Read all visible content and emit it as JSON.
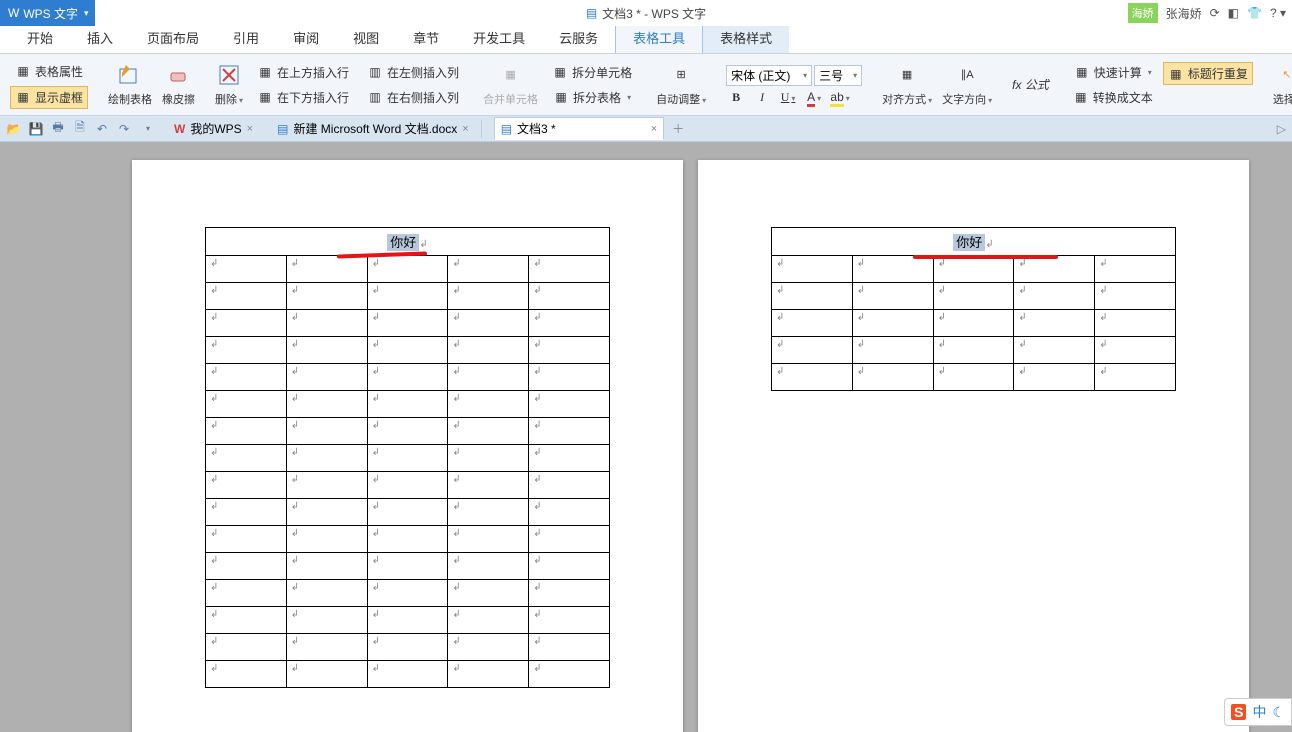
{
  "app": {
    "name": "WPS 文字",
    "doc_title": "文档3 * - WPS 文字"
  },
  "user": {
    "badge": "海娇",
    "name": "张海娇"
  },
  "menu": {
    "items": [
      "开始",
      "插入",
      "页面布局",
      "引用",
      "审阅",
      "视图",
      "章节",
      "开发工具",
      "云服务",
      "表格工具",
      "表格样式"
    ],
    "active": "表格工具"
  },
  "ribbon": {
    "table_props": "表格属性",
    "show_grid": "显示虚框",
    "draw": "绘制表格",
    "eraser": "橡皮擦",
    "delete": "删除",
    "ins_above": "在上方插入行",
    "ins_below": "在下方插入行",
    "ins_left": "在左侧插入列",
    "ins_right": "在右侧插入列",
    "merge": "合并单元格",
    "split_cell": "拆分单元格",
    "split_table": "拆分表格",
    "autofit": "自动调整",
    "font_name": "宋体 (正文)",
    "font_size": "三号",
    "align": "对齐方式",
    "text_dir": "文字方向",
    "formula": "fx 公式",
    "quick_calc": "快速计算",
    "header_repeat": "标题行重复",
    "to_text": "转换成文本",
    "select": "选择"
  },
  "qat": {
    "mywps": "我的WPS",
    "doc1": "新建 Microsoft Word 文档.docx",
    "doc2": "文档3 *"
  },
  "content": {
    "header_text": "你好",
    "cell_mark": "↲"
  },
  "ime": {
    "char": "中"
  }
}
